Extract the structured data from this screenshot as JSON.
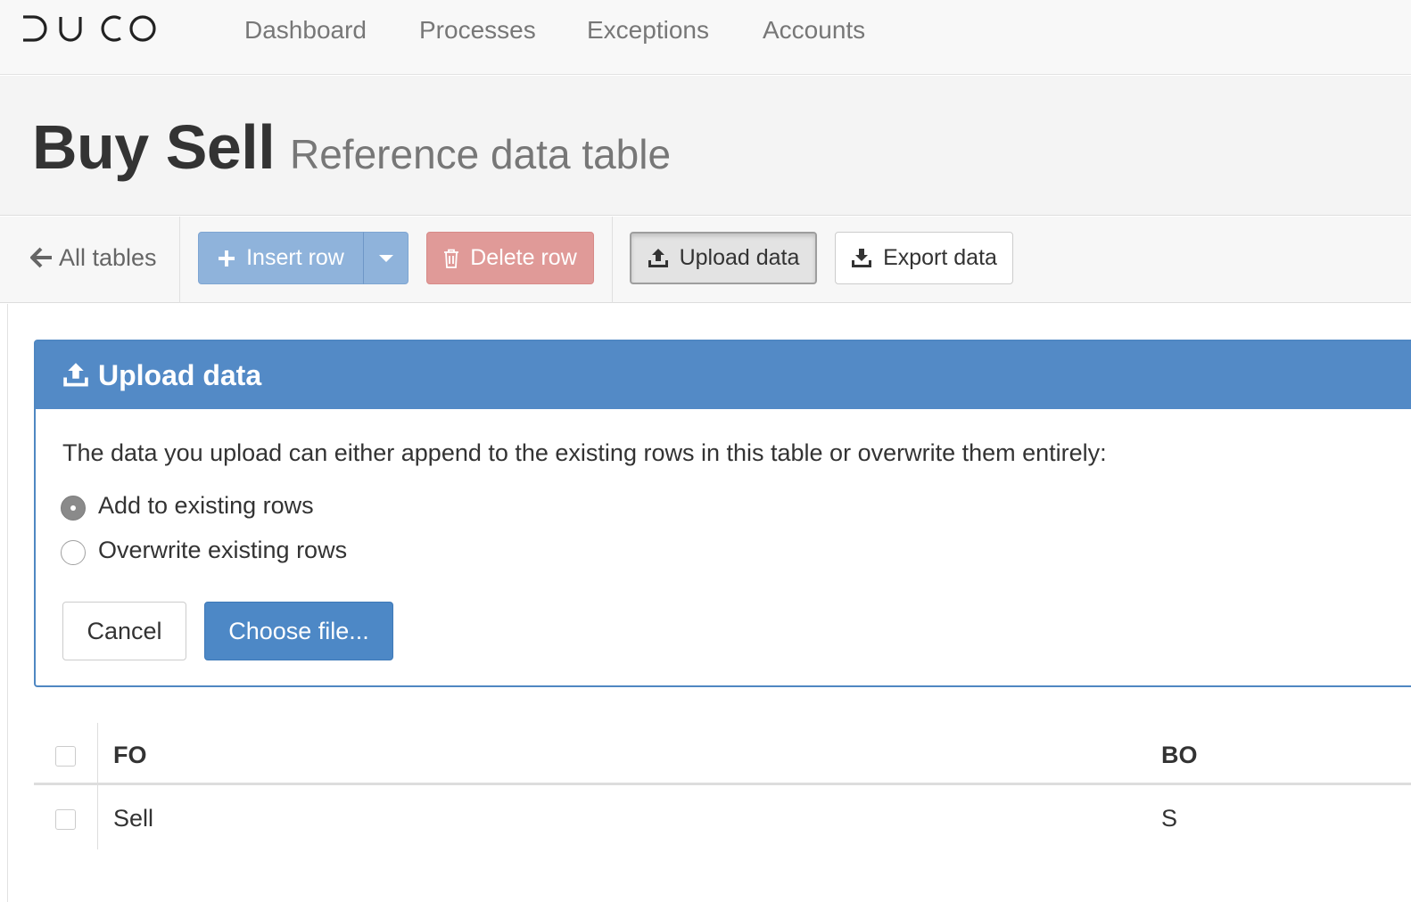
{
  "nav": {
    "logo": "DUCO",
    "items": [
      "Dashboard",
      "Processes",
      "Exceptions",
      "Accounts"
    ]
  },
  "header": {
    "title": "Buy Sell",
    "subtitle": "Reference data table"
  },
  "toolbar": {
    "back_label": "All tables",
    "insert_label": "Insert row",
    "delete_label": "Delete row",
    "upload_label": "Upload data",
    "export_label": "Export data"
  },
  "upload_panel": {
    "title": "Upload data",
    "description": "The data you upload can either append to the existing rows in this table or overwrite them entirely:",
    "options": [
      {
        "label": "Add to existing rows",
        "selected": true
      },
      {
        "label": "Overwrite existing rows",
        "selected": false
      }
    ],
    "cancel_label": "Cancel",
    "choose_label": "Choose file..."
  },
  "table": {
    "columns": [
      "FO",
      "BO"
    ],
    "rows": [
      {
        "fo": "Sell",
        "bo": "S"
      }
    ]
  },
  "colors": {
    "primary": "#538ac6",
    "danger": "#e09a98",
    "muted_text": "#777777"
  }
}
